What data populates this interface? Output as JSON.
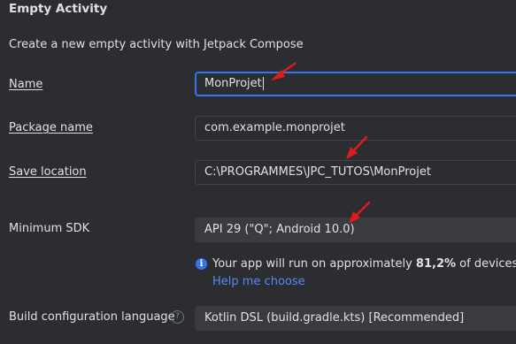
{
  "header": {
    "title": "Empty Activity",
    "subtitle": "Create a new empty activity with Jetpack Compose"
  },
  "form": {
    "name": {
      "label": "Name",
      "value": "MonProjet"
    },
    "package_name": {
      "label": "Package name",
      "value": "com.example.monprojet"
    },
    "save_location": {
      "label": "Save location",
      "value": "C:\\PROGRAMMES\\JPC_TUTOS\\MonProjet"
    },
    "minimum_sdk": {
      "label": "Minimum SDK",
      "value": "API 29 (\"Q\"; Android 10.0)"
    },
    "sdk_info": {
      "icon": "info-icon",
      "text_before": "Your app will run on approximately ",
      "percentage": "81,2%",
      "text_after": " of devices.",
      "help_link": "Help me choose"
    },
    "build_language": {
      "label": "Build configuration language",
      "help_icon": "?",
      "value": "Kotlin DSL (build.gradle.kts) [Recommended]"
    }
  },
  "colors": {
    "background": "#2b2d30",
    "focus_border": "#3574f0",
    "link": "#548af7",
    "annotation_arrow": "#e01b1b"
  }
}
